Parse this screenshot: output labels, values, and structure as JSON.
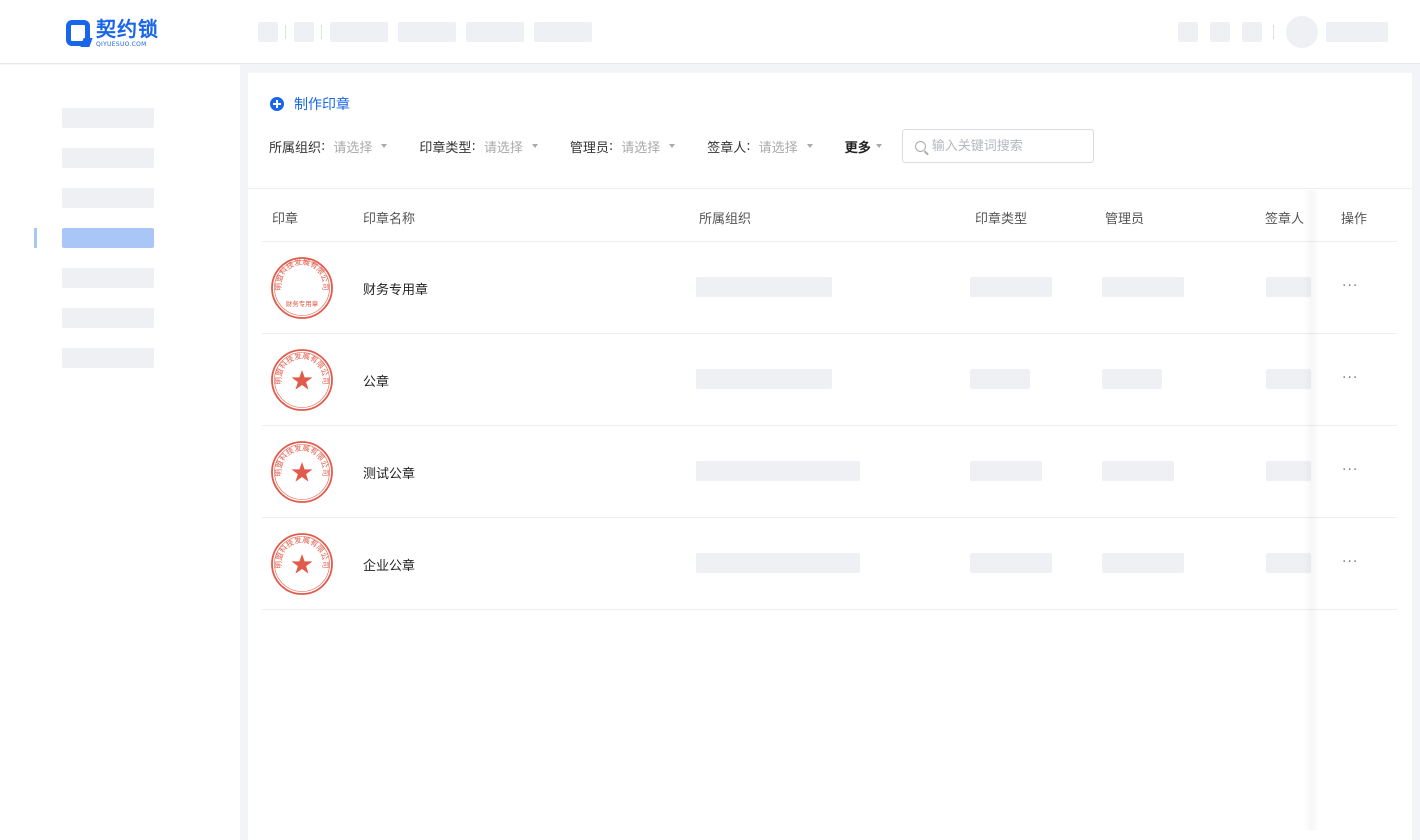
{
  "header": {
    "logo_cn": "契约锁",
    "logo_en": "QIYUESUO.COM"
  },
  "toolbar": {
    "create_label": "制作印章"
  },
  "filters": [
    {
      "label": "所属组织",
      "value": "请选择"
    },
    {
      "label": "印章类型",
      "value": "请选择"
    },
    {
      "label": "管理员",
      "value": "请选择"
    },
    {
      "label": "签章人",
      "value": "请选择"
    }
  ],
  "more_label": "更多",
  "search": {
    "placeholder": "输入关键词搜索"
  },
  "table": {
    "columns": [
      "印章",
      "印章名称",
      "所属组织",
      "印章类型",
      "管理员",
      "签章人",
      "操作"
    ],
    "rows": [
      {
        "name": "财务专用章",
        "seal_ring_text": "明盟科技发展有限公司",
        "seal_center_text": "财务专用章"
      },
      {
        "name": "公章",
        "seal_ring_text": "明盟科技发展有限公司"
      },
      {
        "name": "测试公章",
        "seal_ring_text": "明盟科技发展有限公司"
      },
      {
        "name": "企业公章",
        "seal_ring_text": "明盟科技发展有限公司"
      }
    ],
    "row_action": "···"
  },
  "colors": {
    "accent": "#1a66e8",
    "seal": "#e25a4a",
    "skeleton": "#eef0f4",
    "active_nav": "#a9c6f7"
  }
}
